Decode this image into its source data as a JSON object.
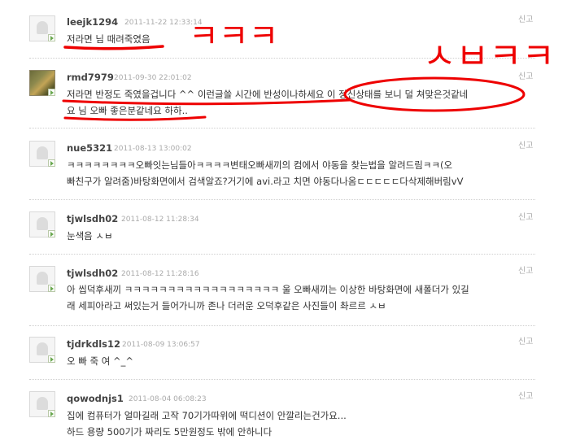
{
  "report_label": "신고",
  "comments": [
    {
      "username": "leejk1294",
      "timestamp": "2011-11-22 12:33:14",
      "text": "저라면 님 때려죽였음",
      "avatar": "default"
    },
    {
      "username": "rmd7979",
      "timestamp": "2011-09-30 22:01:02",
      "text": "저라면 반정도 죽였을겁니다 ^^ 이런글쓸 시간에 반성이나하세요 이 정신상태를 보니 덜 쳐맞은것같네\n요 님 오빠 좋은분같네요 하하..",
      "avatar": "photo"
    },
    {
      "username": "nue5321",
      "timestamp": "2011-08-13 13:00:02",
      "text": "ㅋㅋㅋㅋㅋㅋㅋㅋ오빠잇는님들아ㅋㅋㅋㅋ변태오빠새끼의 컴에서 야동을 찾는법을 알려드림ㅋㅋ(오\n빠친구가 알려줌)바탕화면에서 검색알죠?거기에 avi.라고 치면 야동다나옴ㄷㄷㄷㄷㄷ다삭제해버림vV",
      "avatar": "default"
    },
    {
      "username": "tjwlsdh02",
      "timestamp": "2011-08-12 11:28:34",
      "text": "눈색음 ㅅㅂ",
      "avatar": "default"
    },
    {
      "username": "tjwlsdh02",
      "timestamp": "2011-08-12 11:28:16",
      "text": "아 씹덕후새끼 ㅋㅋㅋㅋㅋㅋㅋㅋㅋㅋㅋㅋㅋㅋㅋㅋㅋㅋ 울 오빠새끼는 이상한 바탕화면에 새폴더가 있길\n래 세피아라고 써있는거 들어가니까 존나 더러운 오덕후같은 사진들이 촤르르 ㅅㅂ",
      "avatar": "default"
    },
    {
      "username": "tjdrkdls12",
      "timestamp": "2011-08-09 13:06:57",
      "text": "오 빠 죽 여 ^_^",
      "avatar": "default"
    },
    {
      "username": "qowodnjs1",
      "timestamp": "2011-08-04 06:08:23",
      "text": "집에 컴퓨터가 얼마길래 고작 70기가따위에 떡디션이 안깔리는건가요...\n하드 용량 500기가 짜리도 5만원정도 밖에 안하니다",
      "avatar": "default"
    }
  ],
  "annotations": {
    "handwriting_1": "ㅋㅋㅋ",
    "handwriting_2": "ㅅㅂㅋㅋ",
    "ink_color": "#ee0000"
  }
}
